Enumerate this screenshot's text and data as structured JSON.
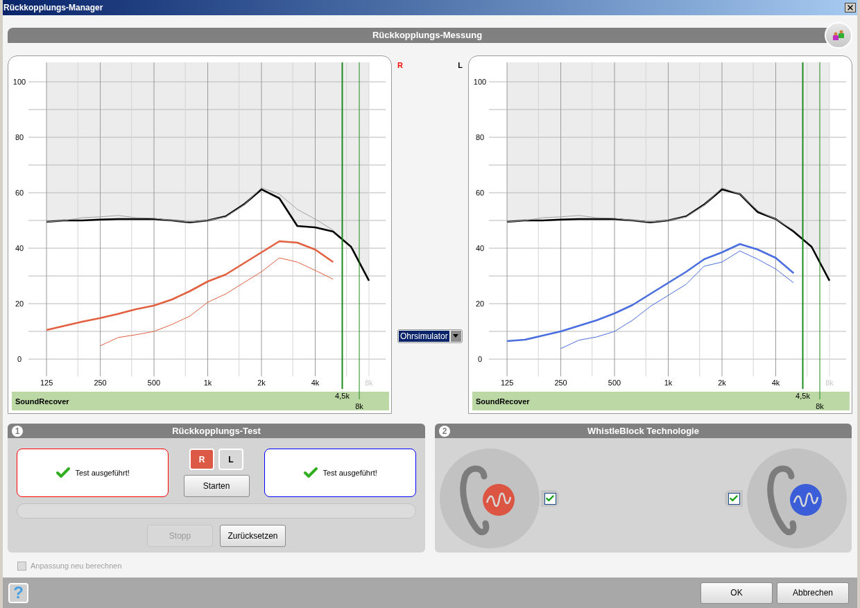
{
  "window": {
    "title": "Rückkopplungs-Manager"
  },
  "measurement": {
    "title": "Rückkopplungs-Messung",
    "charts": [
      {
        "side": {
          "label": "R",
          "color": "#ff0000"
        },
        "band": "SoundRecover",
        "chart_data": {
          "type": "line",
          "categories": [
            "125",
            null,
            null,
            "250",
            null,
            null,
            "500",
            null,
            null,
            "1k",
            null,
            null,
            "2k",
            null,
            null,
            "4k",
            null,
            null,
            "8k"
          ],
          "series": [
            {
              "color": "#000000",
              "values": [
                49.5,
                50,
                50,
                50.3,
                50.5,
                50.5,
                50.5,
                50,
                49.3,
                50,
                51.5,
                55.7,
                61.2,
                58,
                48,
                47.5,
                46,
                40.5,
                28.3
              ]
            },
            {
              "color": "#a0a0a0",
              "values": [
                49.5,
                50,
                51,
                51.3,
                51.8,
                51,
                50.8,
                50,
                49.5,
                50,
                51.3,
                55.5,
                61.8,
                59.5,
                54,
                50.5,
                46.5,
                null,
                null
              ]
            },
            {
              "color": "#e2603f",
              "values": [
                10.5,
                12,
                13.5,
                14.8,
                16.3,
                18,
                19.3,
                21.5,
                24.5,
                28,
                30.5,
                34.5,
                38.5,
                42.5,
                42,
                39.5,
                35,
                null,
                null
              ]
            },
            {
              "color": "#e2603f",
              "values": [
                null,
                null,
                null,
                4.8,
                7.8,
                8.8,
                10,
                12.5,
                15.5,
                20.5,
                23.5,
                27.5,
                31.5,
                36.5,
                35,
                32,
                28.8,
                null,
                null
              ]
            }
          ],
          "grid": true,
          "ylim": [
            -6.25,
            107
          ],
          "yticks": [
            0,
            20,
            40,
            60,
            80,
            100
          ],
          "annotations": [
            "4,5k",
            "8k"
          ]
        }
      },
      {
        "side": {
          "label": "L",
          "color": "#000000"
        },
        "band": "SoundRecover",
        "chart_data": {
          "type": "line",
          "categories": [
            "125",
            null,
            null,
            "250",
            null,
            null,
            "500",
            null,
            null,
            "1k",
            null,
            null,
            "2k",
            null,
            null,
            "4k",
            null,
            null,
            "8k"
          ],
          "series": [
            {
              "color": "#000000",
              "values": [
                49.5,
                50,
                50,
                50.3,
                50.5,
                50.5,
                50.5,
                50,
                49.3,
                50,
                51.5,
                55.7,
                61.2,
                59.5,
                53,
                50.5,
                46,
                40.5,
                28.3
              ]
            },
            {
              "color": "#a0a0a0",
              "values": [
                49.5,
                50,
                51,
                51.3,
                51.8,
                51,
                50.8,
                50,
                49.5,
                50,
                51.3,
                55.5,
                61.8,
                59.5,
                53.5,
                50.5,
                46.5,
                null,
                null
              ]
            },
            {
              "color": "#4a6ee0",
              "values": [
                6.5,
                7,
                8.5,
                10,
                12,
                14,
                16.5,
                19.5,
                23.5,
                27.5,
                31.5,
                36,
                38.5,
                41.5,
                39.5,
                36.5,
                31,
                null,
                null
              ]
            },
            {
              "color": "#4a6ee0",
              "values": [
                null,
                null,
                null,
                3.8,
                6.8,
                8,
                10,
                14,
                19,
                23,
                27,
                33.5,
                35,
                39,
                36,
                32.5,
                27.5,
                null,
                null
              ]
            }
          ],
          "grid": true,
          "ylim": [
            -6.25,
            107
          ],
          "yticks": [
            0,
            20,
            40,
            60,
            80,
            100
          ],
          "annotations": [
            "4,5k",
            "8k"
          ]
        }
      }
    ],
    "transducer_select": {
      "value": "Ohrsimulator"
    }
  },
  "feedback_test": {
    "number": "1",
    "title": "Rückkopplungs-Test",
    "results": [
      {
        "text": "Test ausgeführt!",
        "color": "#ff0000",
        "done": true
      },
      {
        "text": "Test ausgeführt!",
        "color": "#0000ff",
        "done": true
      }
    ],
    "ear_buttons": [
      {
        "label": "R",
        "selected": true
      },
      {
        "label": "L",
        "selected": false
      }
    ],
    "start_button": "Starten",
    "progress": {
      "level": 0
    },
    "stop_button": {
      "label": "Stopp",
      "disabled": true
    },
    "reset_button": {
      "label": "Zurücksetzen",
      "disabled": false
    }
  },
  "whistleblock": {
    "number": "2",
    "title": "WhistleBlock Technologie",
    "ears": [
      {
        "color": "#dc5543",
        "checked": true
      },
      {
        "color": "#3b5ed8",
        "checked": true
      }
    ]
  },
  "recalculate": {
    "label": "Anpassung neu berechnen",
    "checked": false,
    "disabled": true
  },
  "help_button": "?",
  "buttons": [
    "OK",
    "Abbrechen"
  ]
}
